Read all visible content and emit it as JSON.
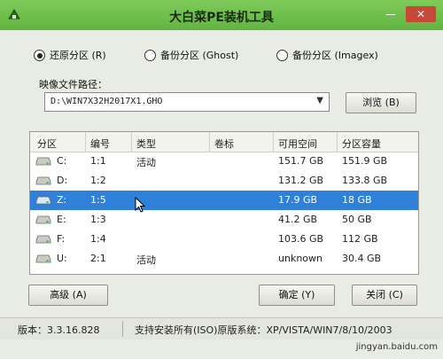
{
  "window": {
    "title": "大白菜PE装机工具",
    "minimize": "—",
    "close": "✕"
  },
  "modes": [
    {
      "label": "还原分区 (R)",
      "selected": true
    },
    {
      "label": "备份分区 (Ghost)",
      "selected": false
    },
    {
      "label": "备份分区 (Imagex)",
      "selected": false
    }
  ],
  "path": {
    "label": "映像文件路径：",
    "value": "D:\\WIN7X32H2017X1.GHO",
    "browse": "浏览 (B)"
  },
  "table": {
    "headers": [
      "分区",
      "编号",
      "类型",
      "卷标",
      "可用空间",
      "分区容量"
    ],
    "rows": [
      {
        "drive": "C:",
        "id": "1:1",
        "type": "活动",
        "label": "",
        "free": "151.7 GB",
        "size": "151.9 GB",
        "selected": false
      },
      {
        "drive": "D:",
        "id": "1:2",
        "type": "",
        "label": "",
        "free": "131.2 GB",
        "size": "133.8 GB",
        "selected": false
      },
      {
        "drive": "Z:",
        "id": "1:5",
        "type": "",
        "label": "",
        "free": "17.9 GB",
        "size": "18 GB",
        "selected": true
      },
      {
        "drive": "E:",
        "id": "1:3",
        "type": "",
        "label": "",
        "free": "41.2 GB",
        "size": "50 GB",
        "selected": false
      },
      {
        "drive": "F:",
        "id": "1:4",
        "type": "",
        "label": "",
        "free": "103.6 GB",
        "size": "112 GB",
        "selected": false
      },
      {
        "drive": "U:",
        "id": "2:1",
        "type": "活动",
        "label": "",
        "free": "unknown",
        "size": "30.4 GB",
        "selected": false
      }
    ]
  },
  "buttons": {
    "advanced": "高级 (A)",
    "ok": "确定 (Y)",
    "close": "关闭 (C)"
  },
  "status": {
    "version": "版本：3.3.16.828",
    "support": "支持安装所有(ISO)原版系统：XP/VISTA/WIN7/8/10/2003"
  },
  "watermark": "jingyan.baidu.com",
  "colors": {
    "titlebar": "#6cbd4a",
    "selection": "#2f80d8",
    "close_button": "#c84838"
  }
}
